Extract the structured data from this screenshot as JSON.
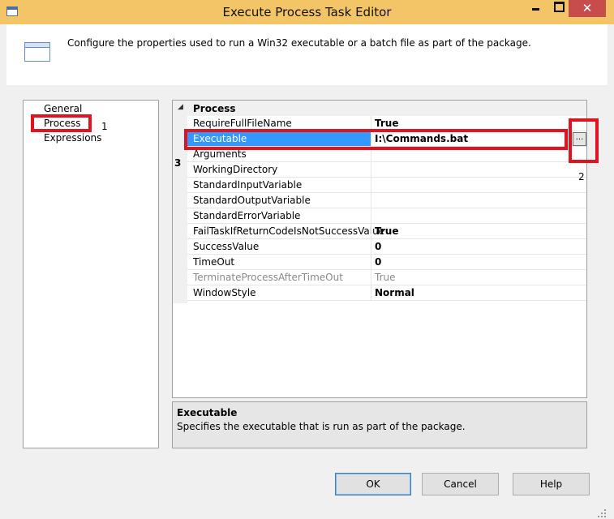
{
  "window": {
    "title": "Execute Process Task Editor",
    "minimize": "",
    "maximize": "",
    "close": "✕"
  },
  "header": {
    "description": "Configure the properties used to run a Win32 executable or a batch file as part of the package."
  },
  "nav": {
    "items": [
      "General",
      "Process",
      "Expressions"
    ]
  },
  "grid": {
    "category": "Process",
    "expander": "◢",
    "rows": [
      {
        "name": "RequireFullFileName",
        "value": "True"
      },
      {
        "name": "Executable",
        "value": "I:\\Commands.bat"
      },
      {
        "name": "Arguments",
        "value": ""
      },
      {
        "name": "WorkingDirectory",
        "value": ""
      },
      {
        "name": "StandardInputVariable",
        "value": ""
      },
      {
        "name": "StandardOutputVariable",
        "value": ""
      },
      {
        "name": "StandardErrorVariable",
        "value": ""
      },
      {
        "name": "FailTaskIfReturnCodeIsNotSuccessValue",
        "value": "True"
      },
      {
        "name": "SuccessValue",
        "value": "0"
      },
      {
        "name": "TimeOut",
        "value": "0"
      },
      {
        "name": "TerminateProcessAfterTimeOut",
        "value": "True"
      },
      {
        "name": "WindowStyle",
        "value": "Normal"
      }
    ],
    "ellipsis": "..."
  },
  "help": {
    "title": "Executable",
    "text": "Specifies the executable that is run as part of the package."
  },
  "buttons": {
    "ok": "OK",
    "cancel": "Cancel",
    "help": "Help"
  },
  "annotations": {
    "n1": "1",
    "n2": "2",
    "n3": "3"
  },
  "colors": {
    "title_bar": "#f4c566",
    "close_button": "#c74d4d",
    "selection": "#3399ff",
    "annotation": "#e0141e"
  }
}
